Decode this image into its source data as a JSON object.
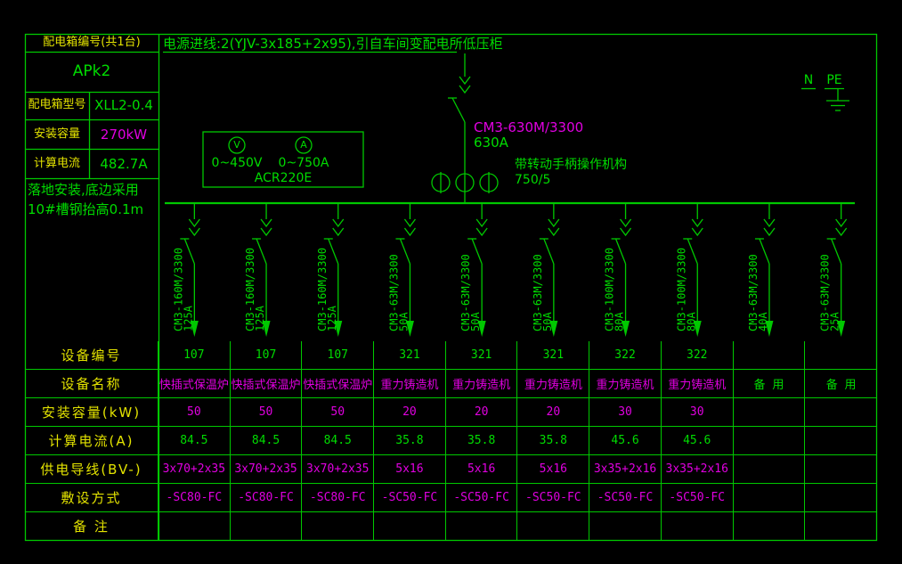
{
  "colors": {
    "line": "#00c800",
    "green": "#00dc00",
    "yellow": "#e2e200",
    "magenta": "#e000e0",
    "background": "#000000"
  },
  "panel": {
    "box_id_label": "配电箱编号(共1台)",
    "box_id": "APk2",
    "model_label": "配电箱型号",
    "model": "XLL2-0.4",
    "capacity_label": "安装容量",
    "capacity": "270kW",
    "current_label": "计算电流",
    "current": "482.7A",
    "note_line1": "落地安装,底边采用",
    "note_line2": "10#槽钢抬高0.1m"
  },
  "header": {
    "incoming_text": "电源进线:2(YJV-3x185+2x95),引自车间变配电所低压柜"
  },
  "incoming": {
    "breaker_model": "CM3-630M/3300",
    "breaker_rating": "630A",
    "operator_note": "带转动手柄操作机构",
    "ct_ratio": "750/5"
  },
  "meter": {
    "v_icon": "V",
    "a_icon": "A",
    "v_range": "0~450V",
    "a_range": "0~750A",
    "model": "ACR220E"
  },
  "bus_labels": {
    "n": "N",
    "pe": "PE"
  },
  "feeders": [
    {
      "model": "CM3-160M/3300",
      "rating": "125A"
    },
    {
      "model": "CM3-160M/3300",
      "rating": "125A"
    },
    {
      "model": "CM3-160M/3300",
      "rating": "125A"
    },
    {
      "model": "CM3-63M/3300",
      "rating": "50A"
    },
    {
      "model": "CM3-63M/3300",
      "rating": "50A"
    },
    {
      "model": "CM3-63M/3300",
      "rating": "50A"
    },
    {
      "model": "CM3-100M/3300",
      "rating": "80A"
    },
    {
      "model": "CM3-100M/3300",
      "rating": "80A"
    },
    {
      "model": "CM3-63M/3300",
      "rating": "40A"
    },
    {
      "model": "CM3-63M/3300",
      "rating": "25A"
    }
  ],
  "table": {
    "rows": [
      {
        "label": "设备编号",
        "color": "green",
        "cells": [
          "107",
          "107",
          "107",
          "321",
          "321",
          "321",
          "322",
          "322",
          "",
          ""
        ]
      },
      {
        "label": "设备名称",
        "color": "magenta",
        "cells": [
          "快插式保温炉",
          "快插式保温炉",
          "快插式保温炉",
          "重力铸造机",
          "重力铸造机",
          "重力铸造机",
          "重力铸造机",
          "重力铸造机",
          "备 用",
          "备 用"
        ],
        "cell_colors": {
          "8": "green",
          "9": "green"
        }
      },
      {
        "label": "安装容量(kW)",
        "color": "magenta",
        "cells": [
          "50",
          "50",
          "50",
          "20",
          "20",
          "20",
          "30",
          "30",
          "",
          ""
        ]
      },
      {
        "label": "计算电流(A)",
        "color": "green",
        "cells": [
          "84.5",
          "84.5",
          "84.5",
          "35.8",
          "35.8",
          "35.8",
          "45.6",
          "45.6",
          "",
          ""
        ]
      },
      {
        "label": "供电导线(BV-)",
        "color": "magenta",
        "cells": [
          "3x70+2x35",
          "3x70+2x35",
          "3x70+2x35",
          "5x16",
          "5x16",
          "5x16",
          "3x35+2x16",
          "3x35+2x16",
          "",
          ""
        ]
      },
      {
        "label": "敷设方式",
        "color": "magenta",
        "cells": [
          "-SC80-FC",
          "-SC80-FC",
          "-SC80-FC",
          "-SC50-FC",
          "-SC50-FC",
          "-SC50-FC",
          "-SC50-FC",
          "-SC50-FC",
          "",
          ""
        ]
      },
      {
        "label": "备 注",
        "color": "green",
        "cells": [
          "",
          "",
          "",
          "",
          "",
          "",
          "",
          "",
          "",
          ""
        ]
      }
    ]
  }
}
